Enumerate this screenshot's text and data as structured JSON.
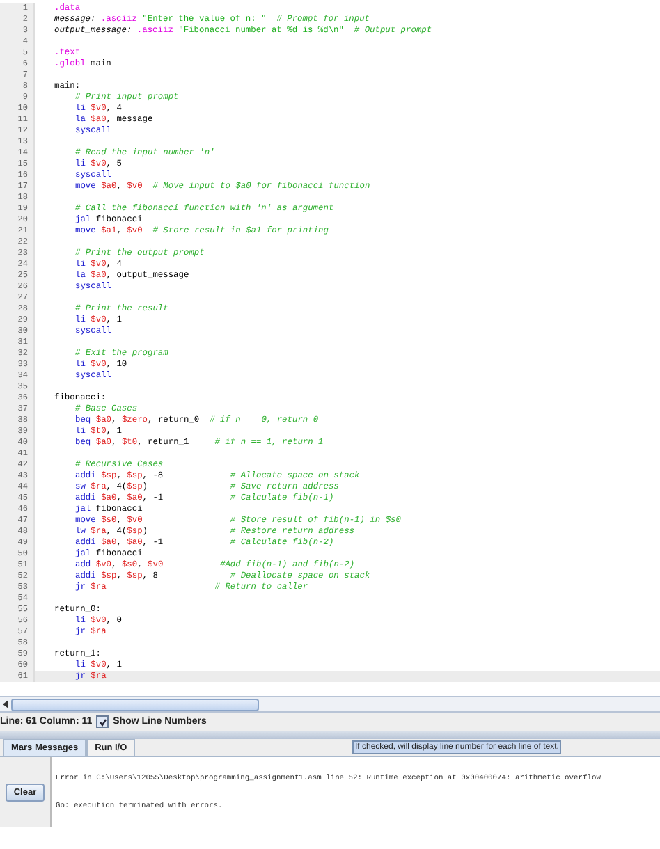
{
  "editor": {
    "lines": [
      {
        "n": "1",
        "t": [
          {
            "kind": "dir",
            "text": ".data"
          }
        ]
      },
      {
        "n": "2",
        "t": [
          {
            "kind": "label",
            "text": "message: "
          },
          {
            "kind": "dir",
            "text": ".asciiz "
          },
          {
            "kind": "str",
            "text": "\"Enter the value of n: \"  "
          },
          {
            "kind": "cmt",
            "text": "# Prompt for input"
          }
        ]
      },
      {
        "n": "3",
        "t": [
          {
            "kind": "label",
            "text": "output_message: "
          },
          {
            "kind": "dir",
            "text": ".asciiz "
          },
          {
            "kind": "str",
            "text": "\"Fibonacci number at %d is %d\\n\"  "
          },
          {
            "kind": "cmt",
            "text": "# Output prompt"
          }
        ]
      },
      {
        "n": "4"
      },
      {
        "n": "5",
        "t": [
          {
            "kind": "dir",
            "text": ".text"
          }
        ]
      },
      {
        "n": "6",
        "t": [
          {
            "kind": "dir",
            "text": ".globl "
          },
          {
            "kind": "plain",
            "text": "main"
          }
        ]
      },
      {
        "n": "7"
      },
      {
        "n": "8",
        "t": [
          {
            "kind": "plain",
            "text": "main:"
          }
        ],
        "children": [
          {
            "n": "9",
            "t": [
              {
                "kind": "cmt",
                "text": "# Print input prompt"
              }
            ]
          },
          {
            "n": "10",
            "t": [
              {
                "kind": "ins",
                "text": "li "
              },
              {
                "kind": "reg",
                "text": "$v0"
              },
              {
                "kind": "plain",
                "text": ", 4"
              }
            ]
          },
          {
            "n": "11",
            "t": [
              {
                "kind": "ins",
                "text": "la "
              },
              {
                "kind": "reg",
                "text": "$a0"
              },
              {
                "kind": "plain",
                "text": ", message"
              }
            ]
          },
          {
            "n": "12",
            "t": [
              {
                "kind": "ins",
                "text": "syscall"
              }
            ]
          },
          {
            "n": "13"
          },
          {
            "n": "14",
            "t": [
              {
                "kind": "cmt",
                "text": "# Read the input number 'n'"
              }
            ]
          },
          {
            "n": "15",
            "t": [
              {
                "kind": "ins",
                "text": "li "
              },
              {
                "kind": "reg",
                "text": "$v0"
              },
              {
                "kind": "plain",
                "text": ", 5"
              }
            ]
          },
          {
            "n": "16",
            "t": [
              {
                "kind": "ins",
                "text": "syscall"
              }
            ]
          },
          {
            "n": "17",
            "t": [
              {
                "kind": "ins",
                "text": "move "
              },
              {
                "kind": "reg",
                "text": "$a0"
              },
              {
                "kind": "plain",
                "text": ", "
              },
              {
                "kind": "reg",
                "text": "$v0  "
              },
              {
                "kind": "cmt",
                "text": "# Move input to $a0 for fibonacci function"
              }
            ]
          },
          {
            "n": "18"
          },
          {
            "n": "19",
            "t": [
              {
                "kind": "cmt",
                "text": "# Call the fibonacci function with 'n' as argument"
              }
            ]
          },
          {
            "n": "20",
            "t": [
              {
                "kind": "ins",
                "text": "jal "
              },
              {
                "kind": "plain",
                "text": "fibonacci"
              }
            ]
          },
          {
            "n": "21",
            "t": [
              {
                "kind": "ins",
                "text": "move "
              },
              {
                "kind": "reg",
                "text": "$a1"
              },
              {
                "kind": "plain",
                "text": ", "
              },
              {
                "kind": "reg",
                "text": "$v0  "
              },
              {
                "kind": "cmt",
                "text": "# Store result in $a1 for printing"
              }
            ]
          },
          {
            "n": "22"
          },
          {
            "n": "23",
            "t": [
              {
                "kind": "cmt",
                "text": "# Print the output prompt"
              }
            ]
          },
          {
            "n": "24",
            "t": [
              {
                "kind": "ins",
                "text": "li "
              },
              {
                "kind": "reg",
                "text": "$v0"
              },
              {
                "kind": "plain",
                "text": ", 4"
              }
            ]
          },
          {
            "n": "25",
            "t": [
              {
                "kind": "ins",
                "text": "la "
              },
              {
                "kind": "reg",
                "text": "$a0"
              },
              {
                "kind": "plain",
                "text": ", output_message"
              }
            ]
          },
          {
            "n": "26",
            "t": [
              {
                "kind": "ins",
                "text": "syscall"
              }
            ]
          },
          {
            "n": "27"
          },
          {
            "n": "28",
            "t": [
              {
                "kind": "cmt",
                "text": "# Print the result"
              }
            ]
          },
          {
            "n": "29",
            "t": [
              {
                "kind": "ins",
                "text": "li "
              },
              {
                "kind": "reg",
                "text": "$v0"
              },
              {
                "kind": "plain",
                "text": ", 1"
              }
            ]
          },
          {
            "n": "30",
            "t": [
              {
                "kind": "ins",
                "text": "syscall"
              }
            ]
          },
          {
            "n": "31"
          },
          {
            "n": "32",
            "t": [
              {
                "kind": "cmt",
                "text": "# Exit the program"
              }
            ]
          },
          {
            "n": "33",
            "t": [
              {
                "kind": "ins",
                "text": "li "
              },
              {
                "kind": "reg",
                "text": "$v0"
              },
              {
                "kind": "plain",
                "text": ", 10"
              }
            ]
          },
          {
            "n": "34",
            "t": [
              {
                "kind": "ins",
                "text": "syscall"
              }
            ]
          }
        ]
      },
      {
        "n": "35"
      },
      {
        "n": "36",
        "t": [
          {
            "kind": "plain",
            "text": "fibonacci:"
          }
        ],
        "children": [
          {
            "n": "37",
            "t": [
              {
                "kind": "cmt",
                "text": "# Base Cases"
              }
            ]
          },
          {
            "n": "38",
            "t": [
              {
                "kind": "ins",
                "text": "beq "
              },
              {
                "kind": "reg",
                "text": "$a0"
              },
              {
                "kind": "plain",
                "text": ", "
              },
              {
                "kind": "reg",
                "text": "$zero"
              },
              {
                "kind": "plain",
                "text": ", return_0  "
              },
              {
                "kind": "cmt",
                "text": "# if n == 0, return 0"
              }
            ]
          },
          {
            "n": "39",
            "t": [
              {
                "kind": "ins",
                "text": "li "
              },
              {
                "kind": "reg",
                "text": "$t0"
              },
              {
                "kind": "plain",
                "text": ", 1"
              }
            ]
          },
          {
            "n": "40",
            "t": [
              {
                "kind": "ins",
                "text": "beq "
              },
              {
                "kind": "reg",
                "text": "$a0"
              },
              {
                "kind": "plain",
                "text": ", "
              },
              {
                "kind": "reg",
                "text": "$t0"
              },
              {
                "kind": "plain",
                "text": ", return_1     "
              },
              {
                "kind": "cmt",
                "text": "# if n == 1, return 1"
              }
            ]
          },
          {
            "n": "41"
          },
          {
            "n": "42",
            "t": [
              {
                "kind": "cmt",
                "text": "# Recursive Cases"
              }
            ]
          },
          {
            "n": "43",
            "t": [
              {
                "kind": "ins",
                "text": "addi "
              },
              {
                "kind": "reg",
                "text": "$sp"
              },
              {
                "kind": "plain",
                "text": ", "
              },
              {
                "kind": "reg",
                "text": "$sp"
              },
              {
                "kind": "plain",
                "text": ", -8             "
              },
              {
                "kind": "cmt",
                "text": "# Allocate space on stack"
              }
            ]
          },
          {
            "n": "44",
            "t": [
              {
                "kind": "ins",
                "text": "sw "
              },
              {
                "kind": "reg",
                "text": "$ra"
              },
              {
                "kind": "plain",
                "text": ", 4("
              },
              {
                "kind": "reg",
                "text": "$sp"
              },
              {
                "kind": "plain",
                "text": ")                "
              },
              {
                "kind": "cmt",
                "text": "# Save return address"
              }
            ]
          },
          {
            "n": "45",
            "t": [
              {
                "kind": "ins",
                "text": "addi "
              },
              {
                "kind": "reg",
                "text": "$a0"
              },
              {
                "kind": "plain",
                "text": ", "
              },
              {
                "kind": "reg",
                "text": "$a0"
              },
              {
                "kind": "plain",
                "text": ", -1             "
              },
              {
                "kind": "cmt",
                "text": "# Calculate fib(n-1)"
              }
            ]
          },
          {
            "n": "46",
            "t": [
              {
                "kind": "ins",
                "text": "jal "
              },
              {
                "kind": "plain",
                "text": "fibonacci"
              }
            ]
          },
          {
            "n": "47",
            "t": [
              {
                "kind": "ins",
                "text": "move "
              },
              {
                "kind": "reg",
                "text": "$s0"
              },
              {
                "kind": "plain",
                "text": ", "
              },
              {
                "kind": "reg",
                "text": "$v0                 "
              },
              {
                "kind": "cmt",
                "text": "# Store result of fib(n-1) in $s0"
              }
            ]
          },
          {
            "n": "48",
            "t": [
              {
                "kind": "ins",
                "text": "lw "
              },
              {
                "kind": "reg",
                "text": "$ra"
              },
              {
                "kind": "plain",
                "text": ", 4("
              },
              {
                "kind": "reg",
                "text": "$sp"
              },
              {
                "kind": "plain",
                "text": ")                "
              },
              {
                "kind": "cmt",
                "text": "# Restore return address"
              }
            ]
          },
          {
            "n": "49",
            "t": [
              {
                "kind": "ins",
                "text": "addi "
              },
              {
                "kind": "reg",
                "text": "$a0"
              },
              {
                "kind": "plain",
                "text": ", "
              },
              {
                "kind": "reg",
                "text": "$a0"
              },
              {
                "kind": "plain",
                "text": ", -1             "
              },
              {
                "kind": "cmt",
                "text": "# Calculate fib(n-2)"
              }
            ]
          },
          {
            "n": "50",
            "t": [
              {
                "kind": "ins",
                "text": "jal "
              },
              {
                "kind": "plain",
                "text": "fibonacci"
              }
            ]
          },
          {
            "n": "51",
            "t": [
              {
                "kind": "ins",
                "text": "add "
              },
              {
                "kind": "reg",
                "text": "$v0"
              },
              {
                "kind": "plain",
                "text": ", "
              },
              {
                "kind": "reg",
                "text": "$s0"
              },
              {
                "kind": "plain",
                "text": ", "
              },
              {
                "kind": "reg",
                "text": "$v0           "
              },
              {
                "kind": "cmt",
                "text": "#Add fib(n-1) and fib(n-2)"
              }
            ]
          },
          {
            "n": "52",
            "t": [
              {
                "kind": "ins",
                "text": "addi "
              },
              {
                "kind": "reg",
                "text": "$sp"
              },
              {
                "kind": "plain",
                "text": ", "
              },
              {
                "kind": "reg",
                "text": "$sp"
              },
              {
                "kind": "plain",
                "text": ", 8              "
              },
              {
                "kind": "cmt",
                "text": "# Deallocate space on stack"
              }
            ]
          },
          {
            "n": "53",
            "t": [
              {
                "kind": "ins",
                "text": "jr "
              },
              {
                "kind": "reg",
                "text": "$ra                     "
              },
              {
                "kind": "cmt",
                "text": "# Return to caller"
              }
            ]
          }
        ]
      },
      {
        "n": "54"
      },
      {
        "n": "55",
        "t": [
          {
            "kind": "plain",
            "text": "return_0:"
          }
        ],
        "children": [
          {
            "n": "56",
            "t": [
              {
                "kind": "ins",
                "text": "li "
              },
              {
                "kind": "reg",
                "text": "$v0"
              },
              {
                "kind": "plain",
                "text": ", 0"
              }
            ]
          },
          {
            "n": "57",
            "t": [
              {
                "kind": "ins",
                "text": "jr "
              },
              {
                "kind": "reg",
                "text": "$ra"
              }
            ]
          }
        ]
      },
      {
        "n": "58"
      },
      {
        "n": "59",
        "t": [
          {
            "kind": "plain",
            "text": "return_1:"
          }
        ],
        "children": [
          {
            "n": "60",
            "t": [
              {
                "kind": "ins",
                "text": "li "
              },
              {
                "kind": "reg",
                "text": "$v0"
              },
              {
                "kind": "plain",
                "text": ", 1"
              }
            ]
          },
          {
            "n": "61",
            "current": true,
            "t": [
              {
                "kind": "ins",
                "text": "jr "
              },
              {
                "kind": "reg",
                "text": "$ra"
              }
            ]
          }
        ]
      }
    ]
  },
  "status_bar": {
    "position": "Line: 61 Column: 11",
    "show_line_numbers": {
      "label": "Show Line Numbers",
      "checked": true
    }
  },
  "messages_panel": {
    "tabs": [
      {
        "label": "Mars Messages",
        "selected": true
      },
      {
        "label": "Run I/O",
        "selected": false
      }
    ],
    "tooltip": "If checked, will display line number for each line of text.",
    "clear_button": "Clear",
    "messages": [
      "Error in C:\\Users\\12055\\Desktop\\programming_assignment1.asm line 52: Runtime exception at 0x00400074: arithmetic overflow",
      "Go: execution terminated with errors."
    ]
  }
}
